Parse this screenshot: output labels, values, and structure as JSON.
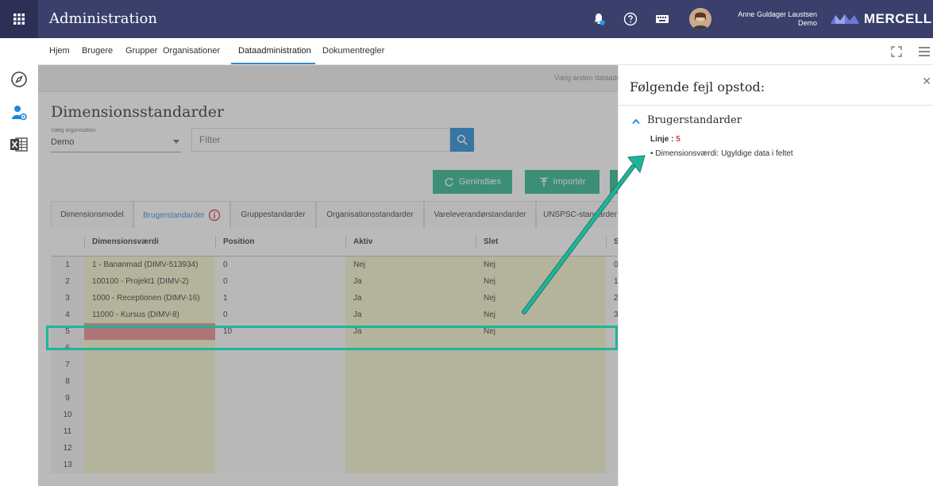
{
  "header": {
    "title": "Administration",
    "user_name": "Anne Guldager Laustsen",
    "user_org": "Demo",
    "logo_text": "MERCELL",
    "colors": {
      "bar": "#3a3f6b",
      "grid_button": "#2c3056",
      "notification_dot": "#2a9bf0"
    }
  },
  "nav": {
    "items": [
      "Hjem",
      "Brugere",
      "Grupper",
      "Organisationer",
      "Dataadministration",
      "Dokumentregler"
    ],
    "active": "Dataadministration"
  },
  "page": {
    "alt_link": "Vælg anden dataadmi",
    "title": "Dimensionsstandarder",
    "org_label": "Vælg organisation",
    "org_value": "Demo",
    "filter_placeholder": "Filter",
    "buttons": {
      "reload": "Genindlæs",
      "import": "Importér"
    },
    "tabs": [
      "Dimensionsmodel",
      "Brugerstandarder",
      "Gruppestandarder",
      "Organisationsstandarder",
      "Vareleverandørstandarder",
      "UNSPSC-standarder"
    ],
    "active_tab": "Brugerstandarder",
    "active_tab_info_icon": "info-icon"
  },
  "grid": {
    "columns": [
      "Dimensionsværdi",
      "Position",
      "Aktiv",
      "Slet",
      "S"
    ],
    "rows": [
      {
        "num": "1",
        "value": "1 - Bananmad (DIMV-513934)",
        "position": "0",
        "aktiv": "Nej",
        "slet": "Nej",
        "extra": "0"
      },
      {
        "num": "2",
        "value": "100100 - Projekt1 (DIMV-2)",
        "position": "0",
        "aktiv": "Ja",
        "slet": "Nej",
        "extra": "1"
      },
      {
        "num": "3",
        "value": "1000 - Receptionen (DIMV-16)",
        "position": "1",
        "aktiv": "Ja",
        "slet": "Nej",
        "extra": "2"
      },
      {
        "num": "4",
        "value": "11000 - Kursus (DIMV-8)",
        "position": "0",
        "aktiv": "Ja",
        "slet": "Nej",
        "extra": "3"
      },
      {
        "num": "5",
        "value": "",
        "position": "10",
        "aktiv": "Ja",
        "slet": "Nej",
        "extra": ""
      },
      {
        "num": "6",
        "value": "",
        "position": "",
        "aktiv": "",
        "slet": "",
        "extra": ""
      },
      {
        "num": "7",
        "value": "",
        "position": "",
        "aktiv": "",
        "slet": "",
        "extra": ""
      },
      {
        "num": "8",
        "value": "",
        "position": "",
        "aktiv": "",
        "slet": "",
        "extra": ""
      },
      {
        "num": "9",
        "value": "",
        "position": "",
        "aktiv": "",
        "slet": "",
        "extra": ""
      },
      {
        "num": "10",
        "value": "",
        "position": "",
        "aktiv": "",
        "slet": "",
        "extra": ""
      },
      {
        "num": "11",
        "value": "",
        "position": "",
        "aktiv": "",
        "slet": "",
        "extra": ""
      },
      {
        "num": "12",
        "value": "",
        "position": "",
        "aktiv": "",
        "slet": "",
        "extra": ""
      },
      {
        "num": "13",
        "value": "",
        "position": "",
        "aktiv": "",
        "slet": "",
        "extra": ""
      }
    ],
    "error_row": "5",
    "colors": {
      "error_cell": "#e8888a",
      "value_column": "#f5f5cc",
      "highlight": "#1fb59a"
    }
  },
  "error_panel": {
    "title": "Følgende fejl opstod:",
    "section": "Brugerstandarder",
    "line_label": "Linje :",
    "line_value": "5",
    "message": "Dimensionsværdi: Ugyldige data i feltet"
  },
  "icons": {
    "topbar": [
      "grid-menu-icon",
      "bell-icon",
      "help-icon",
      "keyboard-icon"
    ],
    "nav": [
      "fullscreen-icon",
      "hamburger-menu-icon"
    ],
    "rail": [
      "compass-icon",
      "user-settings-icon",
      "excel-icon"
    ]
  }
}
